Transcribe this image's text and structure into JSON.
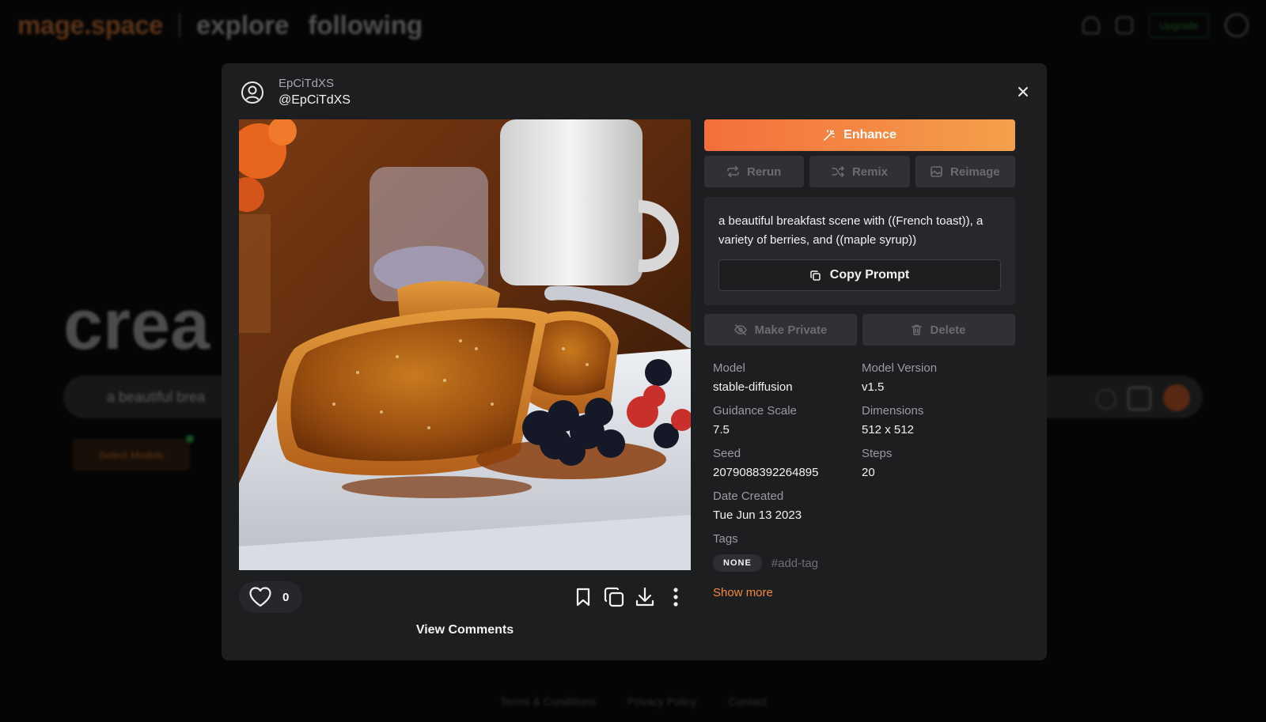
{
  "nav": {
    "brand": "mage.space",
    "links": [
      "explore",
      "following"
    ],
    "upgrade_label": "Upgrade"
  },
  "background": {
    "hero_text": "crea",
    "search_text": "a beautiful brea",
    "chip_label": "Select Models"
  },
  "footer": {
    "links": [
      "Terms & Conditions",
      "Privacy Policy",
      "Contact"
    ]
  },
  "modal": {
    "user": {
      "name": "EpCiTdXS",
      "handle": "@EpCiTdXS"
    },
    "likes": "0",
    "view_comments_label": "View Comments",
    "actions": {
      "enhance_label": "Enhance",
      "rerun_label": "Rerun",
      "remix_label": "Remix",
      "reimage_label": "Reimage",
      "make_private_label": "Make Private",
      "delete_label": "Delete",
      "copy_prompt_label": "Copy Prompt"
    },
    "prompt": "a beautiful breakfast scene with ((French toast)), a variety of berries, and ((maple syrup))",
    "meta": [
      {
        "label": "Model",
        "value": "stable-diffusion"
      },
      {
        "label": "Model Version",
        "value": "v1.5"
      },
      {
        "label": "Guidance Scale",
        "value": "7.5"
      },
      {
        "label": "Dimensions",
        "value": "512 x 512"
      },
      {
        "label": "Seed",
        "value": "2079088392264895"
      },
      {
        "label": "Steps",
        "value": "20"
      },
      {
        "label": "Date Created",
        "value": "Tue Jun 13 2023"
      }
    ],
    "tags_label": "Tags",
    "tags": [
      "NONE"
    ],
    "add_tag_placeholder": "#add-tag",
    "show_more_label": "Show more"
  },
  "colors": {
    "accent": "#f5883a",
    "enhance_start": "#f36f3c",
    "enhance_end": "#f5a04a",
    "modal_bg": "#1d1e20"
  }
}
